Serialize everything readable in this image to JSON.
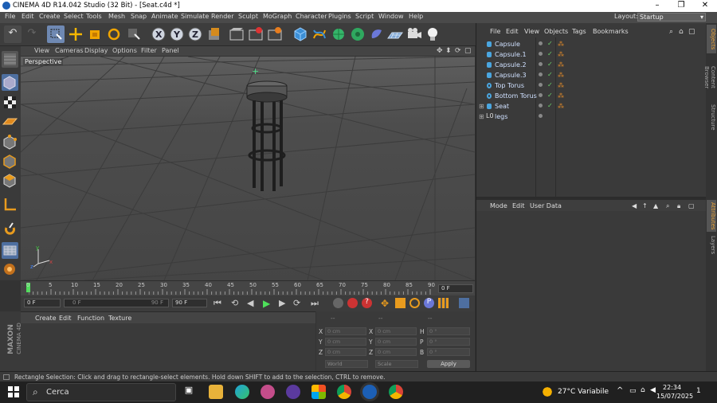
{
  "window": {
    "title": "CINEMA 4D R14.042 Studio (32 Bit) - [Seat.c4d *]",
    "minimize": "–",
    "restore": "❐",
    "close": "✕"
  },
  "menu": [
    "File",
    "Edit",
    "Create",
    "Select",
    "Tools",
    "Mesh",
    "Snap",
    "Animate",
    "Simulate",
    "Render",
    "Sculpt",
    "MoGraph",
    "Character",
    "Plugins",
    "Script",
    "Window",
    "Help"
  ],
  "layout": {
    "label": "Layout:",
    "value": "Startup"
  },
  "viewport": {
    "menu": [
      "View",
      "Cameras",
      "Display",
      "Options",
      "Filter",
      "Panel"
    ],
    "label": "Perspective"
  },
  "timeline": {
    "ticks": [
      "0",
      "5",
      "10",
      "15",
      "20",
      "25",
      "30",
      "35",
      "40",
      "45",
      "50",
      "55",
      "60",
      "65",
      "70",
      "75",
      "80",
      "85",
      "90"
    ],
    "current": "0 F",
    "start": "0 F",
    "range_start": "0 F",
    "range_end": "90 F",
    "end": "90 F"
  },
  "material": {
    "menu": [
      "Create",
      "Edit",
      "Function",
      "Texture"
    ]
  },
  "coords": {
    "headers": [
      "--",
      "--",
      "--"
    ],
    "rows": [
      {
        "a": "X",
        "av": "0 cm",
        "b": "X",
        "bv": "0 cm",
        "c": "H",
        "cv": "0 °"
      },
      {
        "a": "Y",
        "av": "0 cm",
        "b": "Y",
        "bv": "0 cm",
        "c": "P",
        "cv": "0 °"
      },
      {
        "a": "Z",
        "av": "0 cm",
        "b": "Z",
        "bv": "0 cm",
        "c": "B",
        "cv": "0 °"
      }
    ],
    "mode1": "World",
    "mode2": "Scale",
    "apply": "Apply"
  },
  "objects": {
    "menu": [
      "File",
      "Edit",
      "View",
      "Objects",
      "Tags",
      "Bookmarks"
    ],
    "items": [
      "Capsule",
      "Capsule.1",
      "Capsule.2",
      "Capsule.3",
      "Top Torus",
      "Bottom Torus",
      "Seat",
      "legs"
    ]
  },
  "attributes": {
    "menu": [
      "Mode",
      "Edit",
      "User Data"
    ]
  },
  "side_tabs": [
    "Objects",
    "Content Browser",
    "Structure",
    "Attributes",
    "Layers"
  ],
  "logo": {
    "line1": "MAXON",
    "line2": "CINEMA 4D"
  },
  "status": "Rectangle Selection: Click and drag to rectangle-select elements. Hold down SHIFT to add to the selection, CTRL to remove.",
  "taskbar": {
    "search": "Cerca",
    "weather": "27°C Variabile",
    "time": "22:34",
    "date": "15/07/2025",
    "notif": "1"
  }
}
